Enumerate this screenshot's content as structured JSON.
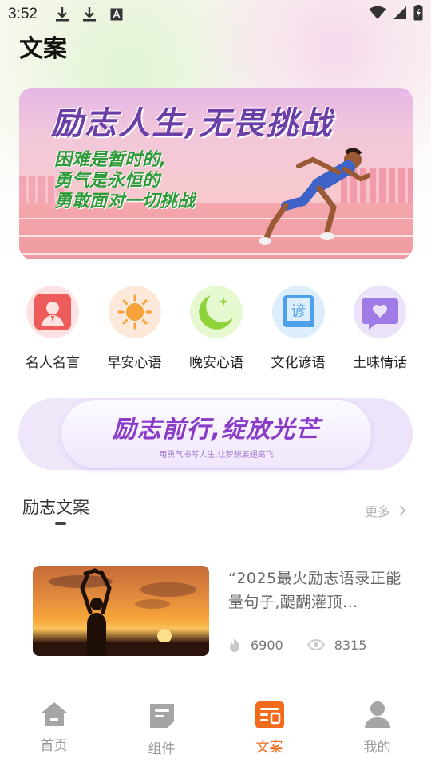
{
  "status_bar": {
    "time": "3:52"
  },
  "header": {
    "title": "文案"
  },
  "banner": {
    "title": "励志人生,无畏挑战",
    "subtitle_lines": [
      "困难是暂时的,",
      "勇气是永恒的",
      "勇敢面对一切挑战"
    ]
  },
  "categories": [
    {
      "label": "名人名言",
      "icon": "person-icon",
      "bg": "#fde2e2",
      "fg": "#ee5b5b"
    },
    {
      "label": "早安心语",
      "icon": "sun-icon",
      "bg": "#fde9da",
      "fg": "#f5a23a"
    },
    {
      "label": "晚安心语",
      "icon": "moon-icon",
      "bg": "#e6f8cf",
      "fg": "#8fd33a"
    },
    {
      "label": "文化谚语",
      "icon": "book-icon",
      "bg": "#dcedfc",
      "fg": "#4ea0ea"
    },
    {
      "label": "土味情话",
      "icon": "heart-chat-icon",
      "bg": "#ece3fb",
      "fg": "#a07be6"
    }
  ],
  "promo": {
    "title": "励志前行,绽放光芒",
    "subtitle": "用勇气书写人生,让梦想展翅高飞"
  },
  "section": {
    "title": "励志文案",
    "more_label": "更多"
  },
  "articles": [
    {
      "title": "“2025最火励志语录正能量句子,醍醐灌顶...",
      "likes": "6900",
      "views": "8315"
    }
  ],
  "bottom_nav": [
    {
      "label": "首页",
      "icon": "home-icon",
      "active": false
    },
    {
      "label": "组件",
      "icon": "widget-icon",
      "active": false
    },
    {
      "label": "文案",
      "icon": "copywriting-icon",
      "active": true
    },
    {
      "label": "我的",
      "icon": "profile-icon",
      "active": false
    }
  ],
  "colors": {
    "accent": "#f26a1b",
    "inactive": "#9a9a9a"
  }
}
